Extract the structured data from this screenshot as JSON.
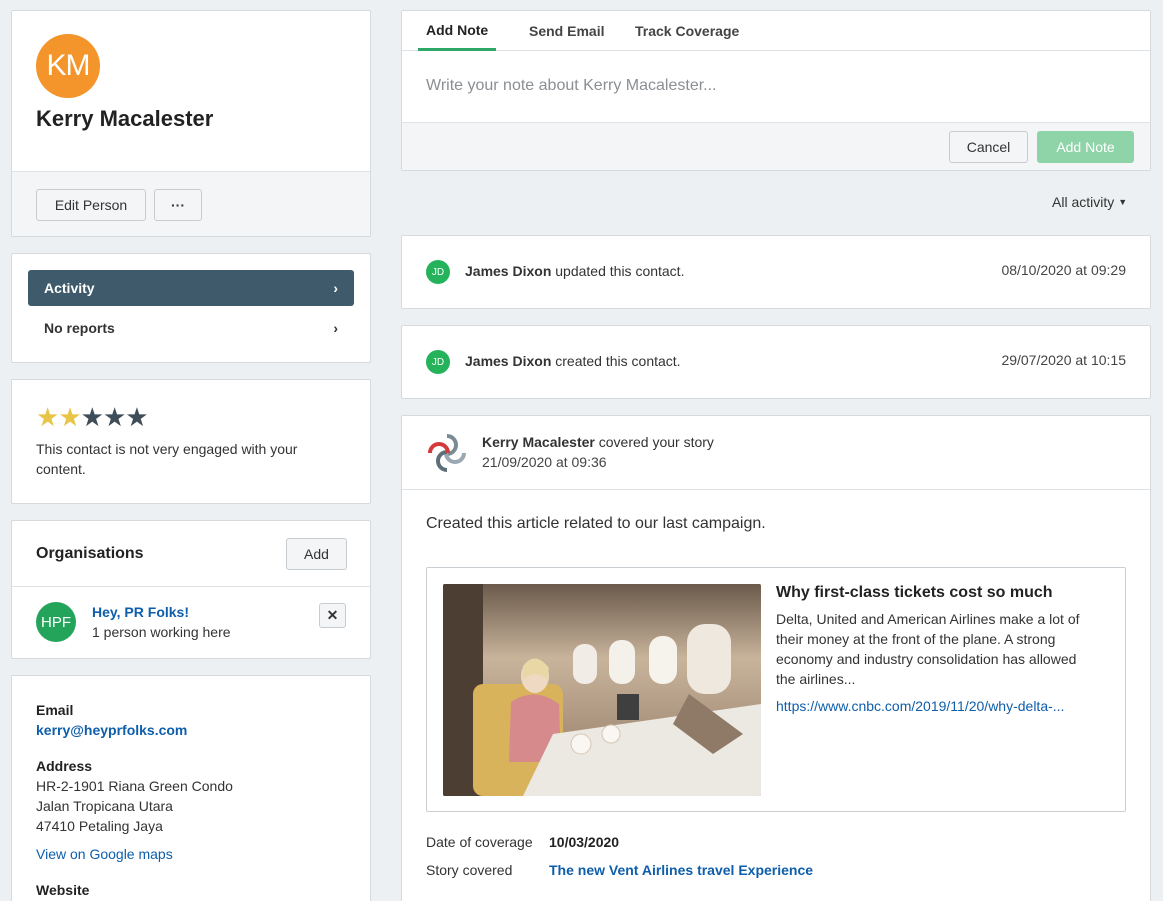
{
  "profile": {
    "initials": "KM",
    "name": "Kerry Macalester",
    "edit_label": "Edit Person",
    "more_label": "···"
  },
  "nav": {
    "items": [
      {
        "label": "Activity",
        "active": true
      },
      {
        "label": "No reports",
        "active": false
      }
    ]
  },
  "engagement": {
    "rating": 2,
    "max": 5,
    "text": "This contact is not very engaged with your content."
  },
  "organisations": {
    "title": "Organisations",
    "add_label": "Add",
    "items": [
      {
        "initials": "HPF",
        "name": "Hey, PR Folks!",
        "subtitle": "1 person working here"
      }
    ]
  },
  "contact": {
    "email_label": "Email",
    "email": "kerry@heyprfolks.com",
    "address_label": "Address",
    "address_lines": [
      "HR-2-1901 Riana Green Condo",
      "Jalan Tropicana Utara",
      "47410 Petaling Jaya"
    ],
    "maps_link": "View on Google maps",
    "website_label": "Website"
  },
  "composer": {
    "tabs": [
      "Add Note",
      "Send Email",
      "Track Coverage"
    ],
    "active_tab": 0,
    "placeholder": "Write your note about Kerry Macalester...",
    "cancel_label": "Cancel",
    "submit_label": "Add Note"
  },
  "filter": {
    "label": "All activity"
  },
  "activity": [
    {
      "initials": "JD",
      "actor": "James Dixon",
      "action": "updated this contact.",
      "date": "08/10/2020 at 09:29"
    },
    {
      "initials": "JD",
      "actor": "James Dixon",
      "action": "created this contact.",
      "date": "29/07/2020 at 10:15"
    }
  ],
  "coverage": {
    "actor": "Kerry Macalester",
    "action": "covered your story",
    "date": "21/09/2020 at 09:36",
    "description": "Created this article related to our last campaign.",
    "article": {
      "title": "Why first-class tickets cost so much",
      "summary": "Delta, United and American Airlines make a lot of their money at the front of the plane. A strong economy and industry consolidation has allowed the airlines...",
      "url": "https://www.cnbc.com/2019/11/20/why-delta-..."
    },
    "date_of_coverage_label": "Date of coverage",
    "date_of_coverage": "10/03/2020",
    "story_covered_label": "Story covered",
    "story_covered": "The new Vent Airlines travel Experience"
  }
}
